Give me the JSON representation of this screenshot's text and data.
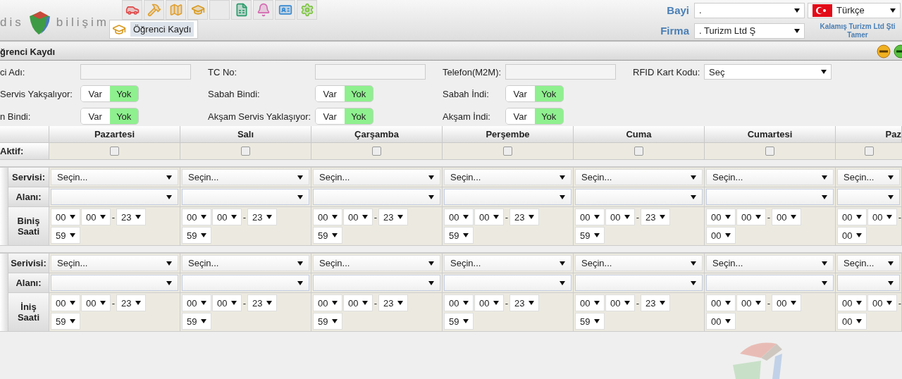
{
  "header": {
    "logo_left": "dis",
    "logo_right": "bilişim",
    "active_tab": "Öğrenci Kaydı",
    "bayi": {
      "label": "Bayi",
      "value": "."
    },
    "language": {
      "value": "Türkçe"
    },
    "firma": {
      "label": "Firma",
      "value": ". Turizm Ltd Ş"
    },
    "user": {
      "company": "Kalamış Turizm Ltd Şti",
      "name": "Tamer"
    }
  },
  "panel": {
    "title": "ğrenci Kaydı"
  },
  "form": [
    [
      {
        "kind": "text",
        "label": "ci Adı:"
      },
      {
        "kind": "text",
        "label": "TC No:"
      },
      {
        "kind": "text",
        "label": "Telefon(M2M):"
      },
      {
        "kind": "select",
        "label": "RFID Kart Kodu:",
        "value": "Seç"
      }
    ],
    [
      {
        "kind": "toggle",
        "label": "Servis Yakşalıyor:",
        "options": [
          {
            "label": "Var",
            "selected": false
          },
          {
            "label": "Yok",
            "selected": true
          }
        ]
      },
      {
        "kind": "toggle",
        "label": "Sabah Bindi:",
        "options": [
          {
            "label": "Var",
            "selected": false
          },
          {
            "label": "Yok",
            "selected": true
          }
        ]
      },
      {
        "kind": "toggle",
        "label": "Sabah İndi:",
        "options": [
          {
            "label": "Var",
            "selected": false
          },
          {
            "label": "Yok",
            "selected": true
          }
        ]
      }
    ],
    [
      {
        "kind": "toggle",
        "label": "n Bindi:",
        "options": [
          {
            "label": "Var",
            "selected": false
          },
          {
            "label": "Yok",
            "selected": true
          }
        ]
      },
      {
        "kind": "toggle",
        "label": "Akşam Servis Yaklaşıyor:",
        "options": [
          {
            "label": "Var",
            "selected": false
          },
          {
            "label": "Yok",
            "selected": true
          }
        ]
      },
      {
        "kind": "toggle",
        "label": "Akşam İndi:",
        "options": [
          {
            "label": "Var",
            "selected": false
          },
          {
            "label": "Yok",
            "selected": true
          }
        ]
      }
    ]
  ],
  "schedule": {
    "aktif_label": "Aktif:",
    "days": [
      {
        "name": "Pazartesi",
        "aktif": false
      },
      {
        "name": "Salı",
        "aktif": false
      },
      {
        "name": "Çarşamba",
        "aktif": false
      },
      {
        "name": "Perşembe",
        "aktif": false
      },
      {
        "name": "Cuma",
        "aktif": false
      },
      {
        "name": "Cumartesi",
        "aktif": false
      },
      {
        "name": "Paz",
        "aktif": false
      }
    ],
    "sections": [
      {
        "service_label": "Servisi:",
        "services": [
          "Seçin...",
          "Seçin...",
          "Seçin...",
          "Seçin...",
          "Seçin...",
          "Seçin...",
          "Seçin..."
        ],
        "area_label": "Alanı:",
        "time_label": "Biniş Saati",
        "times": [
          {
            "start": [
              "00",
              "00"
            ],
            "separator": "-",
            "end": [
              "23",
              "59"
            ]
          },
          {
            "start": [
              "00",
              "00"
            ],
            "separator": "-",
            "end": [
              "23",
              "59"
            ]
          },
          {
            "start": [
              "00",
              "00"
            ],
            "separator": "-",
            "end": [
              "23",
              "59"
            ]
          },
          {
            "start": [
              "00",
              "00"
            ],
            "separator": "-",
            "end": [
              "23",
              "59"
            ]
          },
          {
            "start": [
              "00",
              "00"
            ],
            "separator": "-",
            "end": [
              "23",
              "59"
            ]
          },
          {
            "start": [
              "00",
              "00"
            ],
            "separator": "-",
            "end": [
              "00",
              "00"
            ]
          },
          {
            "start": [
              "00",
              "00"
            ],
            "separator": "-",
            "end": [
              "00"
            ]
          }
        ]
      },
      {
        "service_label": "Serivisi:",
        "services": [
          "Seçin...",
          "Seçin...",
          "Seçin...",
          "Seçin...",
          "Seçin...",
          "Seçin...",
          "Seçin..."
        ],
        "area_label": "Alanı:",
        "time_label": "İniş Saati",
        "times": [
          {
            "start": [
              "00",
              "00"
            ],
            "separator": "-",
            "end": [
              "23",
              "59"
            ]
          },
          {
            "start": [
              "00",
              "00"
            ],
            "separator": "-",
            "end": [
              "23",
              "59"
            ]
          },
          {
            "start": [
              "00",
              "00"
            ],
            "separator": "-",
            "end": [
              "23",
              "59"
            ]
          },
          {
            "start": [
              "00",
              "00"
            ],
            "separator": "-",
            "end": [
              "23",
              "59"
            ]
          },
          {
            "start": [
              "00",
              "00"
            ],
            "separator": "-",
            "end": [
              "23",
              "59"
            ]
          },
          {
            "start": [
              "00",
              "00"
            ],
            "separator": "-",
            "end": [
              "00",
              "00"
            ]
          },
          {
            "start": [
              "00",
              "00"
            ],
            "separator": "-",
            "end": [
              "00"
            ]
          }
        ]
      }
    ]
  }
}
